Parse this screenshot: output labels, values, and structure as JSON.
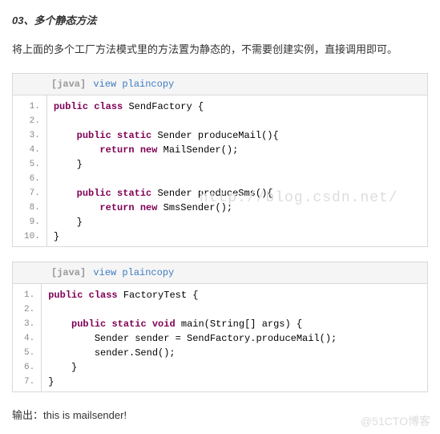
{
  "heading": "03、多个静态方法",
  "paragraph": "将上面的多个工厂方法模式里的方法置为静态的，不需要创建实例，直接调用即可。",
  "code_blocks": [
    {
      "lang": "[java]",
      "link": "view plaincopy",
      "lines": [
        [
          {
            "t": "public",
            "c": "kw"
          },
          {
            "t": " ",
            "c": "plain"
          },
          {
            "t": "class",
            "c": "kw"
          },
          {
            "t": " SendFactory {  ",
            "c": "plain"
          }
        ],
        [
          {
            "t": "      ",
            "c": "plain"
          }
        ],
        [
          {
            "t": "    ",
            "c": "plain"
          },
          {
            "t": "public",
            "c": "kw"
          },
          {
            "t": " ",
            "c": "plain"
          },
          {
            "t": "static",
            "c": "kw"
          },
          {
            "t": " Sender produceMail(){  ",
            "c": "plain"
          }
        ],
        [
          {
            "t": "        ",
            "c": "plain"
          },
          {
            "t": "return",
            "c": "kw"
          },
          {
            "t": " ",
            "c": "plain"
          },
          {
            "t": "new",
            "c": "kw"
          },
          {
            "t": " MailSender();  ",
            "c": "plain"
          }
        ],
        [
          {
            "t": "    }  ",
            "c": "plain"
          }
        ],
        [
          {
            "t": "      ",
            "c": "plain"
          }
        ],
        [
          {
            "t": "    ",
            "c": "plain"
          },
          {
            "t": "public",
            "c": "kw"
          },
          {
            "t": " ",
            "c": "plain"
          },
          {
            "t": "static",
            "c": "kw"
          },
          {
            "t": " Sender produceSms(){  ",
            "c": "plain"
          }
        ],
        [
          {
            "t": "        ",
            "c": "plain"
          },
          {
            "t": "return",
            "c": "kw"
          },
          {
            "t": " ",
            "c": "plain"
          },
          {
            "t": "new",
            "c": "kw"
          },
          {
            "t": " SmsSender();  ",
            "c": "plain"
          }
        ],
        [
          {
            "t": "    }  ",
            "c": "plain"
          }
        ],
        [
          {
            "t": "}  ",
            "c": "plain"
          }
        ]
      ]
    },
    {
      "lang": "[java]",
      "link": "view plaincopy",
      "lines": [
        [
          {
            "t": "public",
            "c": "kw"
          },
          {
            "t": " ",
            "c": "plain"
          },
          {
            "t": "class",
            "c": "kw"
          },
          {
            "t": " FactoryTest {  ",
            "c": "plain"
          }
        ],
        [
          {
            "t": "  ",
            "c": "plain"
          }
        ],
        [
          {
            "t": "    ",
            "c": "plain"
          },
          {
            "t": "public",
            "c": "kw"
          },
          {
            "t": " ",
            "c": "plain"
          },
          {
            "t": "static",
            "c": "kw"
          },
          {
            "t": " ",
            "c": "plain"
          },
          {
            "t": "void",
            "c": "kw"
          },
          {
            "t": " main(String[] args) {      ",
            "c": "plain"
          }
        ],
        [
          {
            "t": "        Sender sender = SendFactory.produceMail();  ",
            "c": "plain"
          }
        ],
        [
          {
            "t": "        sender.Send();  ",
            "c": "plain"
          }
        ],
        [
          {
            "t": "    }  ",
            "c": "plain"
          }
        ],
        [
          {
            "t": "}  ",
            "c": "plain"
          }
        ]
      ]
    }
  ],
  "output_label": "输出：",
  "output_value": "this is mailsender!",
  "watermark1": "http://blog.csdn.net/",
  "watermark2": "@51CTO博客"
}
